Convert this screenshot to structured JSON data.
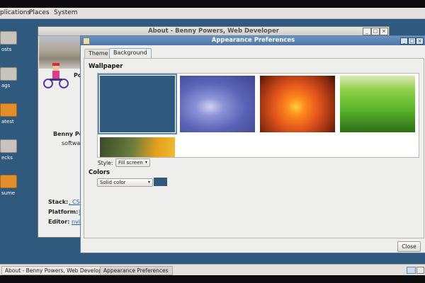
{
  "menubar": {
    "items": [
      "plications",
      "Places",
      "System"
    ]
  },
  "desktop_icons": [
    {
      "label": "osts",
      "icon": "home-folder-icon"
    },
    {
      "label": "ags",
      "icon": "folder-icon"
    },
    {
      "label": "atest",
      "icon": "search-folder-icon"
    },
    {
      "label": "ecks",
      "icon": "presentation-icon"
    },
    {
      "label": "sume",
      "icon": "document-icon"
    }
  ],
  "about_window": {
    "title": "About - Benny Powers, Web Developer",
    "name_partial": "Po",
    "author": "Benny Po",
    "role_partial": "softwa",
    "stack_label": "Stack:",
    "stack_value": ", CS",
    "platform_label": "Platform:",
    "platform_value": "l",
    "editor_label": "Editor:",
    "editor_value": "nvi"
  },
  "appearance_window": {
    "title": "Appearance Preferences",
    "tabs": [
      "Theme",
      "Background"
    ],
    "active_tab": "Background",
    "wallpaper_heading": "Wallpaper",
    "wallpapers": [
      {
        "name": "solid-blue",
        "color": "#2f5a7e",
        "selected": true
      },
      {
        "name": "blue-swirl",
        "color": "#5a63b6"
      },
      {
        "name": "orange-flower",
        "color": "#e3561c"
      },
      {
        "name": "green-grass",
        "color": "#58b52a"
      },
      {
        "name": "yellow-flower",
        "color": "#e6a21d"
      }
    ],
    "style_label": "Style:",
    "style_value": "Fill screen",
    "colors_heading": "Colors",
    "color_mode": "Solid color",
    "color_swatch": "#2f5a7e",
    "close_label": "Close"
  },
  "taskbar": {
    "tasks": [
      "About - Benny Powers, Web Developer",
      "Appearance Preferences"
    ]
  }
}
